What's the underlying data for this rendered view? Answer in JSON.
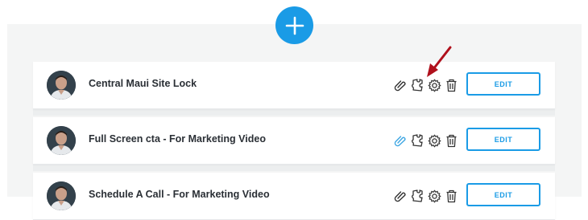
{
  "colors": {
    "accent": "#1a9be6",
    "arrow": "#b0101c",
    "panel": "#f4f5f5",
    "text": "#2a2f35",
    "icon_active": "#3fa7e3"
  },
  "add_button": {
    "icon": "plus-icon"
  },
  "items": [
    {
      "title": "Central Maui Site Lock",
      "edit_label": "EDIT",
      "link_active": false
    },
    {
      "title": "Full Screen cta - For Marketing Video",
      "edit_label": "EDIT",
      "link_active": true
    },
    {
      "title": "Schedule A Call - For Marketing Video",
      "edit_label": "EDIT",
      "link_active": false
    }
  ],
  "item_icons": [
    "paperclip-icon",
    "puzzle-icon",
    "gear-icon",
    "trash-icon"
  ]
}
